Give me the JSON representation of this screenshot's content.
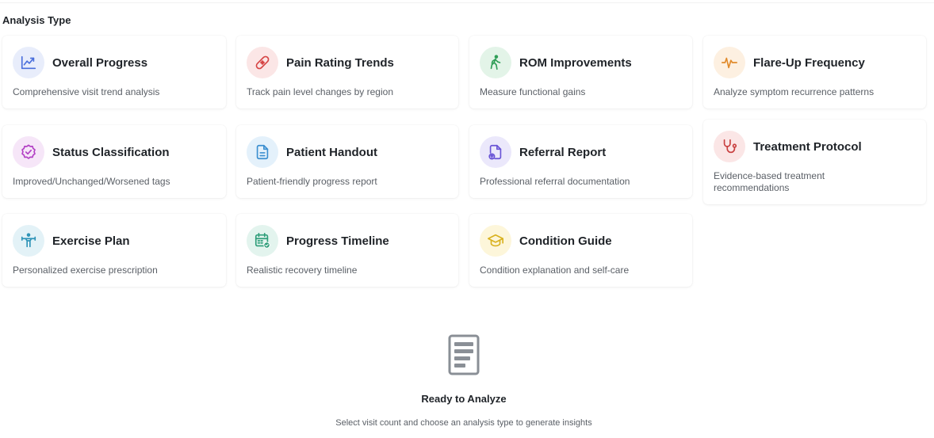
{
  "section_title": "Analysis Type",
  "cards": [
    {
      "title": "Overall Progress",
      "description": "Comprehensive visit trend analysis",
      "icon": "trending-up-icon",
      "icon_bg": "#e8edfb",
      "icon_color": "#4a6fdc"
    },
    {
      "title": "Pain Rating Trends",
      "description": "Track pain level changes by region",
      "icon": "bandage-icon",
      "icon_bg": "#fbe6e6",
      "icon_color": "#d64545"
    },
    {
      "title": "ROM Improvements",
      "description": "Measure functional gains",
      "icon": "walking-icon",
      "icon_bg": "#e3f4e8",
      "icon_color": "#2f9e57"
    },
    {
      "title": "Flare-Up Frequency",
      "description": "Analyze symptom recurrence patterns",
      "icon": "pulse-icon",
      "icon_bg": "#fdf0e1",
      "icon_color": "#e08a2b"
    },
    {
      "title": "Status Classification",
      "description": "Improved/Unchanged/Worsened tags",
      "icon": "badge-check-icon",
      "icon_bg": "#f6e6f8",
      "icon_color": "#b23fc4"
    },
    {
      "title": "Patient Handout",
      "description": "Patient-friendly progress report",
      "icon": "document-icon",
      "icon_bg": "#e4f1fb",
      "icon_color": "#3c8fd0"
    },
    {
      "title": "Referral Report",
      "description": "Professional referral documentation",
      "icon": "file-upload-icon",
      "icon_bg": "#ebe8fb",
      "icon_color": "#6a55d6"
    },
    {
      "title": "Treatment Protocol",
      "description": "Evidence-based treatment recommendations",
      "icon": "stethoscope-icon",
      "icon_bg": "#fbe6e6",
      "icon_color": "#c94040"
    },
    {
      "title": "Exercise Plan",
      "description": "Personalized exercise prescription",
      "icon": "weightlifting-icon",
      "icon_bg": "#e3f2f7",
      "icon_color": "#2f94b8"
    },
    {
      "title": "Progress Timeline",
      "description": "Realistic recovery timeline",
      "icon": "calendar-check-icon",
      "icon_bg": "#e3f4ee",
      "icon_color": "#2f9e7a"
    },
    {
      "title": "Condition Guide",
      "description": "Condition explanation and self-care",
      "icon": "graduation-cap-icon",
      "icon_bg": "#fdf6da",
      "icon_color": "#d9b21f"
    }
  ],
  "empty_state": {
    "icon": "report-document-icon",
    "title": "Ready to Analyze",
    "subtitle": "Select visit count and choose an analysis type to generate insights"
  }
}
